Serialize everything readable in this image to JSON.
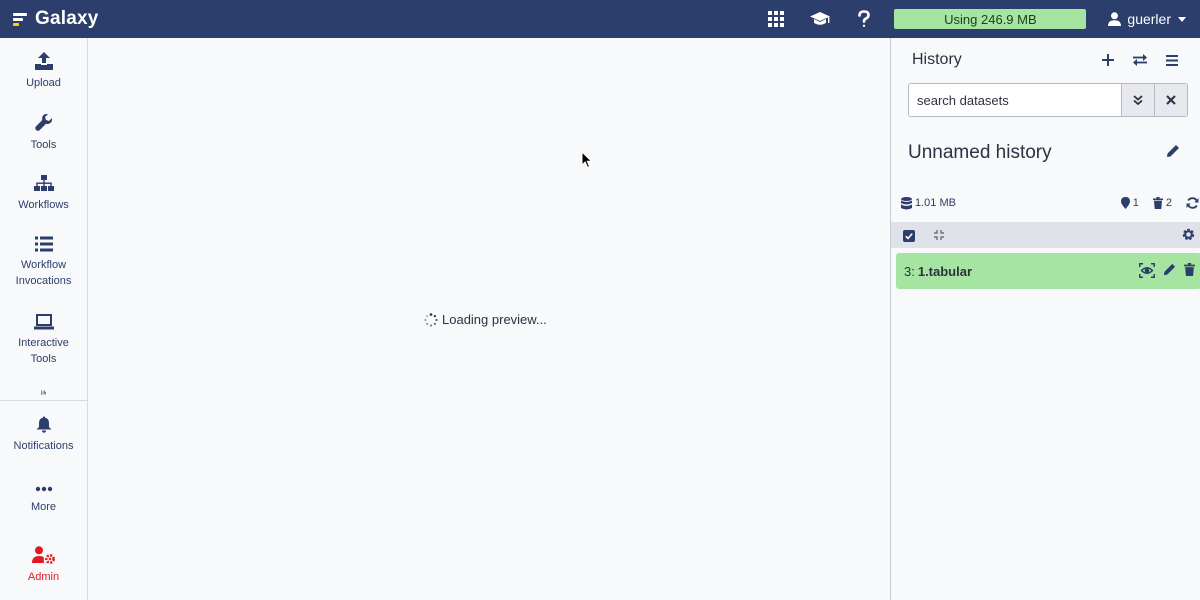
{
  "brand": {
    "name": "Galaxy"
  },
  "topbar": {
    "usage": "Using 246.9 MB",
    "username": "guerler",
    "icons": [
      "apps-grid-icon",
      "graduation-cap-icon",
      "help-icon",
      "user-icon"
    ]
  },
  "sidebar": {
    "items": [
      {
        "label": "Upload",
        "icon": "upload-icon"
      },
      {
        "label": "Tools",
        "icon": "wrench-icon"
      },
      {
        "label": "Workflows",
        "icon": "sitemap-icon"
      },
      {
        "label": "Workflow Invocations",
        "icon": "list-icon"
      },
      {
        "label": "Interactive Tools",
        "icon": "laptop-icon"
      },
      {
        "label": "",
        "icon": "chart-icon"
      },
      {
        "label": "Notifications",
        "icon": "bell-icon"
      },
      {
        "label": "More",
        "icon": "ellipsis-icon"
      },
      {
        "label": "Admin",
        "icon": "user-cog-icon"
      }
    ]
  },
  "center": {
    "loading_text": "Loading preview..."
  },
  "history": {
    "title": "History",
    "search_placeholder": "search datasets",
    "name": "Unnamed history",
    "size": "1.01 MB",
    "shown_count": "1",
    "deleted_count": "2",
    "datasets": [
      {
        "hid": "3:",
        "name": "1.tabular",
        "state_color": "#a6e4a2"
      }
    ]
  },
  "colors": {
    "masthead": "#2c3e6b",
    "usage_bar": "#a6e4a2",
    "admin": "#e31a1c",
    "ok_state": "#a6e4a2"
  }
}
